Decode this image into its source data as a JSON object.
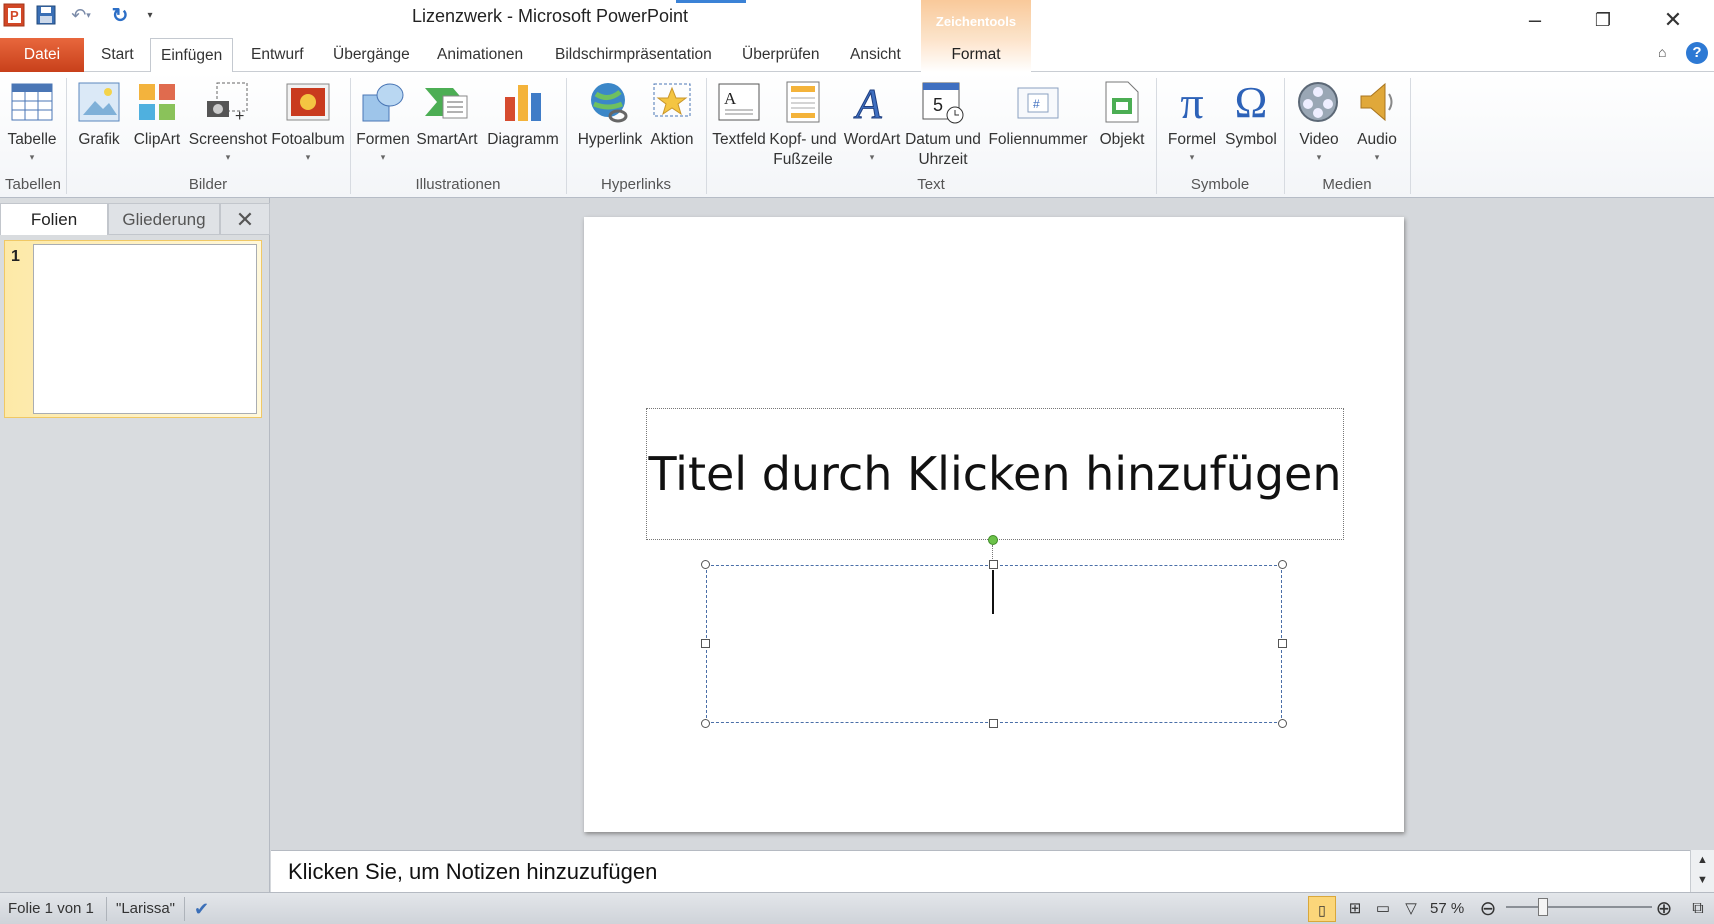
{
  "app": {
    "window_title": "Lizenzwerk - Microsoft PowerPoint",
    "context_group": "Zeichentools"
  },
  "tabs": [
    {
      "label": "Datei"
    },
    {
      "label": "Start"
    },
    {
      "label": "Einfügen"
    },
    {
      "label": "Entwurf"
    },
    {
      "label": "Übergänge"
    },
    {
      "label": "Animationen"
    },
    {
      "label": "Bildschirmpräsentation"
    },
    {
      "label": "Überprüfen"
    },
    {
      "label": "Ansicht"
    },
    {
      "label": "Format"
    }
  ],
  "active_tab": "Einfügen",
  "ribbon": {
    "groups": [
      "Tabellen",
      "Bilder",
      "Illustrationen",
      "Hyperlinks",
      "Text",
      "Symbole",
      "Medien"
    ],
    "buttons": {
      "tabelle": "Tabelle",
      "grafik": "Grafik",
      "clipart": "ClipArt",
      "screenshot": "Screenshot",
      "fotoalbum": "Fotoalbum",
      "formen": "Formen",
      "smartart": "SmartArt",
      "diagramm": "Diagramm",
      "hyperlink": "Hyperlink",
      "aktion": "Aktion",
      "textfeld": "Textfeld",
      "kopf1": "Kopf- und",
      "kopf2": "Fußzeile",
      "wordart": "WordArt",
      "datum1": "Datum und",
      "datum2": "Uhrzeit",
      "foliennummer": "Foliennummer",
      "objekt": "Objekt",
      "formel": "Formel",
      "symbol": "Symbol",
      "video": "Video",
      "audio": "Audio"
    }
  },
  "left_pane": {
    "tab_folien": "Folien",
    "tab_gliederung": "Gliederung",
    "close": "✕",
    "slide_number": "1"
  },
  "slide": {
    "title_placeholder": "Titel durch Klicken hinzufügen"
  },
  "notes": {
    "placeholder": "Klicken Sie, um Notizen hinzuzufügen"
  },
  "status": {
    "slide_info": "Folie 1 von 1",
    "theme": "\"Larissa\"",
    "zoom": "57 %",
    "zoom_fraction": 0.57
  }
}
